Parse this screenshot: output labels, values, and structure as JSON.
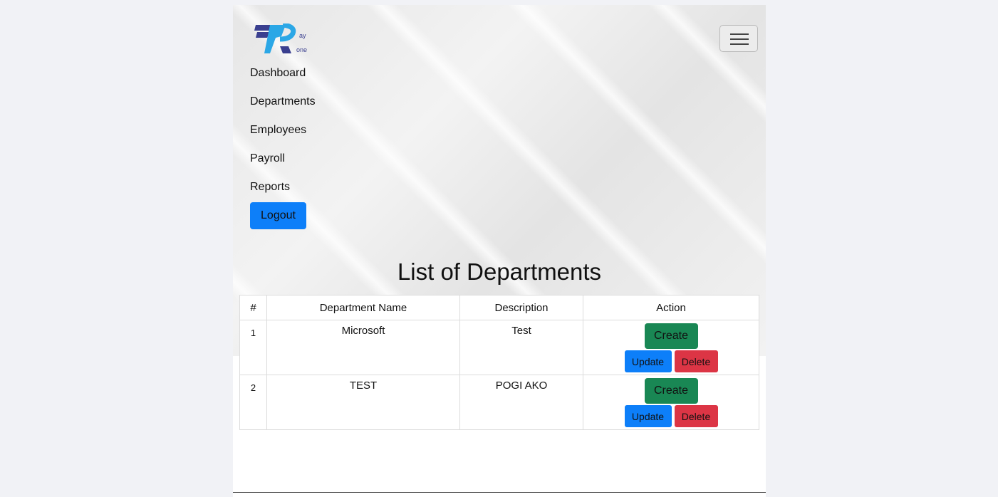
{
  "brand": {
    "logo_text_top": "ay",
    "logo_text_bottom": "one"
  },
  "nav": {
    "toggler_icon": "hamburger-icon",
    "items": [
      {
        "label": "Dashboard"
      },
      {
        "label": "Departments"
      },
      {
        "label": "Employees"
      },
      {
        "label": "Payroll"
      },
      {
        "label": "Reports"
      }
    ],
    "logout_label": "Logout"
  },
  "main": {
    "title": "List of Departments",
    "table": {
      "headers": [
        "#",
        "Department Name",
        "Description",
        "Action"
      ],
      "rows": [
        {
          "num": "1",
          "name": "Microsoft",
          "description": "Test"
        },
        {
          "num": "2",
          "name": "TEST",
          "description": "POGI AKO"
        }
      ],
      "actions": {
        "create": "Create",
        "update": "Update",
        "delete": "Delete"
      }
    }
  },
  "colors": {
    "primary": "#0d7ff9",
    "success": "#198754",
    "danger": "#dc3545",
    "logo_dark": "#3a3f8f",
    "logo_light": "#2ba7e6"
  }
}
